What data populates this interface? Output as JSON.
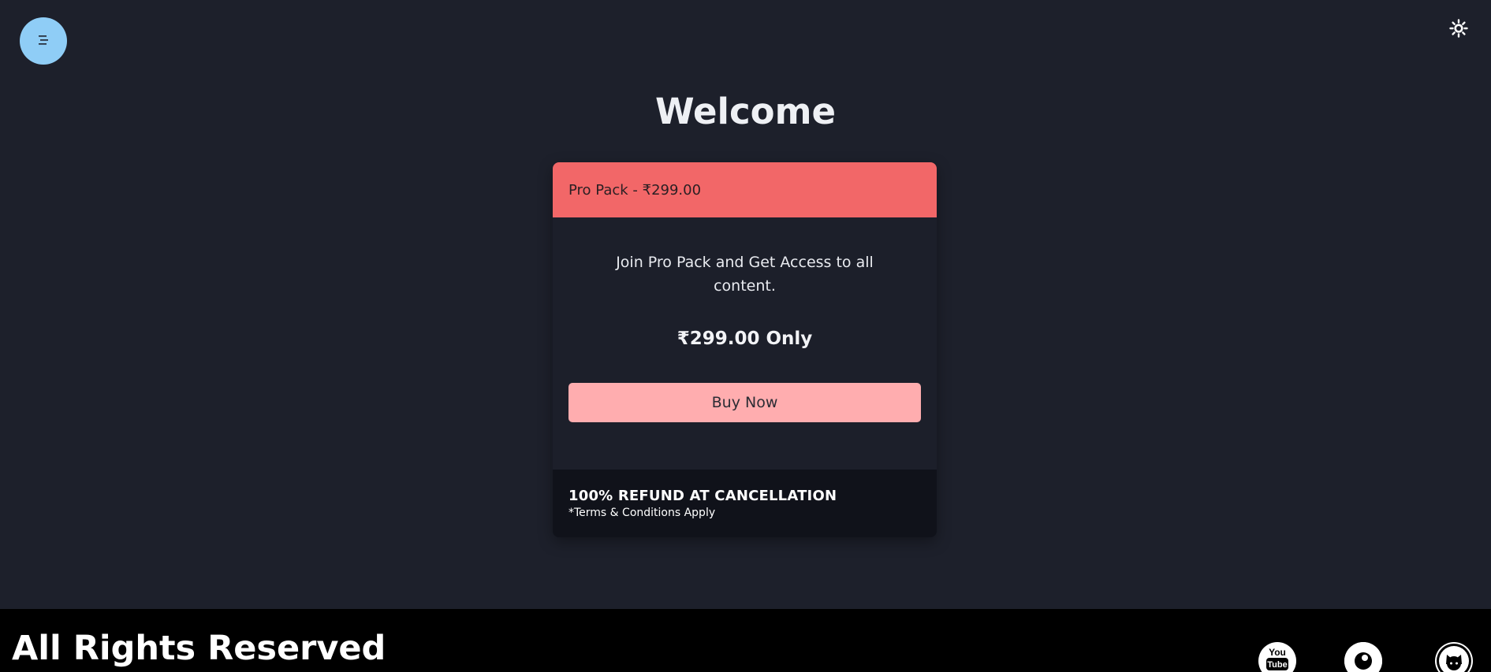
{
  "header": {
    "menu_icon": "hamburger-menu-icon",
    "theme_icon": "sun-icon"
  },
  "main": {
    "title": "Welcome"
  },
  "card": {
    "header_label": "Pro Pack - ₹299.00",
    "description": "Join Pro Pack and Get Access to all content.",
    "price_label": "₹299.00 Only",
    "buy_button_label": "Buy Now",
    "refund_label": "100% REFUND AT CANCELLATION",
    "terms_label": "*Terms & Conditions Apply"
  },
  "footer": {
    "rights_label": "All Rights Reserved",
    "social_icons": [
      "youtube-icon",
      "dribbble-icon",
      "github-icon"
    ]
  },
  "colors": {
    "background": "#1d202b",
    "menu_button": "#8fcdf6",
    "card_header": "#f26768",
    "buy_button": "#ffadaf",
    "card_footer": "#10121a",
    "site_footer": "#000000"
  }
}
